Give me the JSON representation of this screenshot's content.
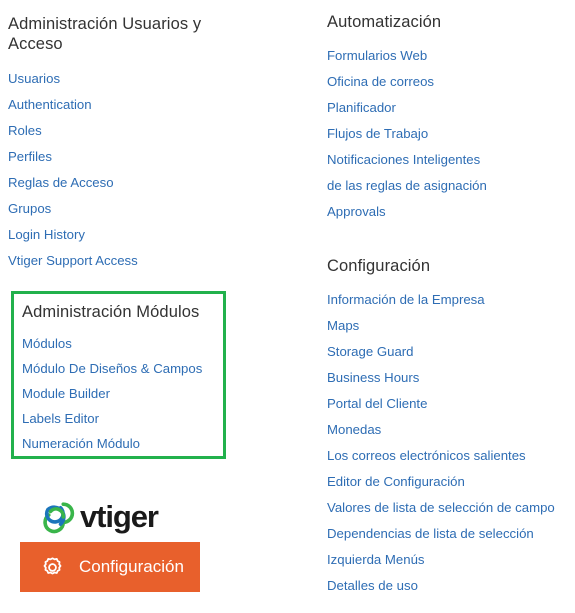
{
  "colors": {
    "link": "#2e6db4",
    "heading": "#333333",
    "highlight_border": "#22b14c",
    "button_background": "#e8602c",
    "button_label": "#ffffff",
    "logo_blue": "#1b75bb",
    "logo_green": "#39b54a",
    "background": "#ffffff"
  },
  "left_column": {
    "users_section": {
      "title": "Administración Usuarios y Acceso",
      "links": [
        "Usuarios",
        "Authentication",
        "Roles",
        "Perfiles",
        "Reglas de Acceso",
        "Grupos",
        "Login History",
        "Vtiger Support Access"
      ]
    },
    "modules_section": {
      "title": "Administración Módulos",
      "highlighted": "true",
      "links": [
        "Módulos",
        "Módulo De Diseños & Campos",
        "Module Builder",
        "Labels Editor",
        "Numeración Módulo"
      ]
    },
    "brand": {
      "logo_icon": "vtiger-cloud-logo-icon",
      "wordmark": "vtiger"
    },
    "config_button": {
      "icon": "gear-icon",
      "label": "Configuración"
    }
  },
  "right_column": {
    "automation_section": {
      "title": "Automatización",
      "links": [
        "Formularios Web",
        "Oficina de correos",
        "Planificador",
        "Flujos de Trabajo",
        "Notificaciones Inteligentes",
        "de las reglas de asignación",
        "Approvals"
      ]
    },
    "settings_section": {
      "title": "Configuración",
      "links": [
        "Información de la Empresa",
        "Maps",
        "Storage Guard",
        "Business Hours",
        "Portal del Cliente",
        "Monedas",
        "Los correos electrónicos salientes",
        "Editor de Configuración",
        "Valores de lista de selección de campo",
        "Dependencias de lista de selección",
        "Izquierda Menús",
        "Detalles de uso"
      ]
    }
  }
}
